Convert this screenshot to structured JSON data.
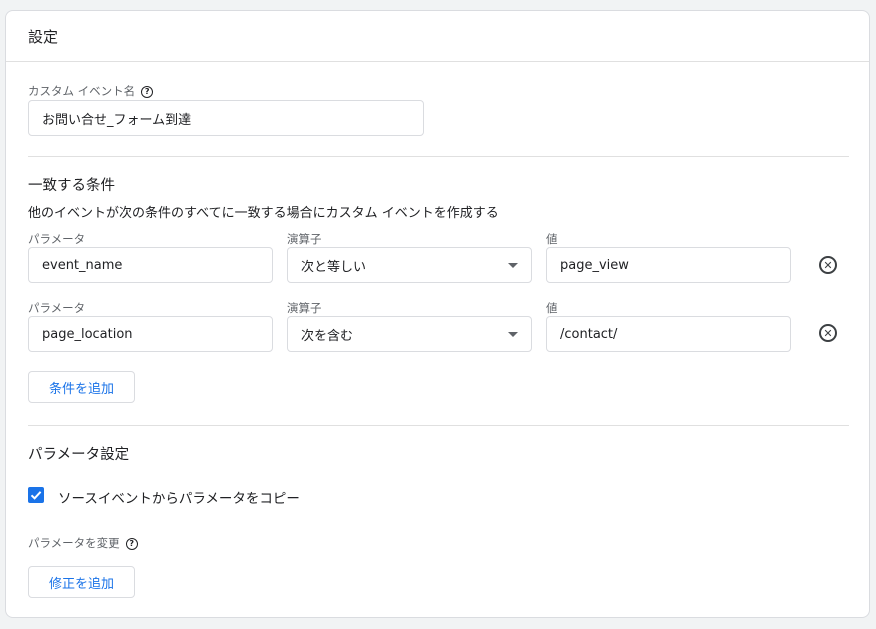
{
  "header": {
    "title": "設定"
  },
  "event_name": {
    "label": "カスタム イベント名",
    "value": "お問い合せ_フォーム到達",
    "help_icon": "help-icon"
  },
  "conditions": {
    "title": "一致する条件",
    "description": "他のイベントが次の条件のすべてに一致する場合にカスタム イベントを作成する",
    "rows": [
      {
        "param_label": "パラメータ",
        "param_value": "event_name",
        "operator_label": "演算子",
        "operator_value": "次と等しい",
        "value_label": "値",
        "value_value": "page_view"
      },
      {
        "param_label": "パラメータ",
        "param_value": "page_location",
        "operator_label": "演算子",
        "operator_value": "次を含む",
        "value_label": "値",
        "value_value": "/contact/"
      }
    ],
    "add_button": "条件を追加"
  },
  "parameter_settings": {
    "title": "パラメータ設定",
    "copy_checkbox_label": "ソースイベントからパラメータをコピー",
    "copy_checked": true,
    "modify_label": "パラメータを変更",
    "add_modification_button": "修正を追加"
  },
  "colors": {
    "accent": "#1a73e8",
    "border": "#dadce0"
  }
}
